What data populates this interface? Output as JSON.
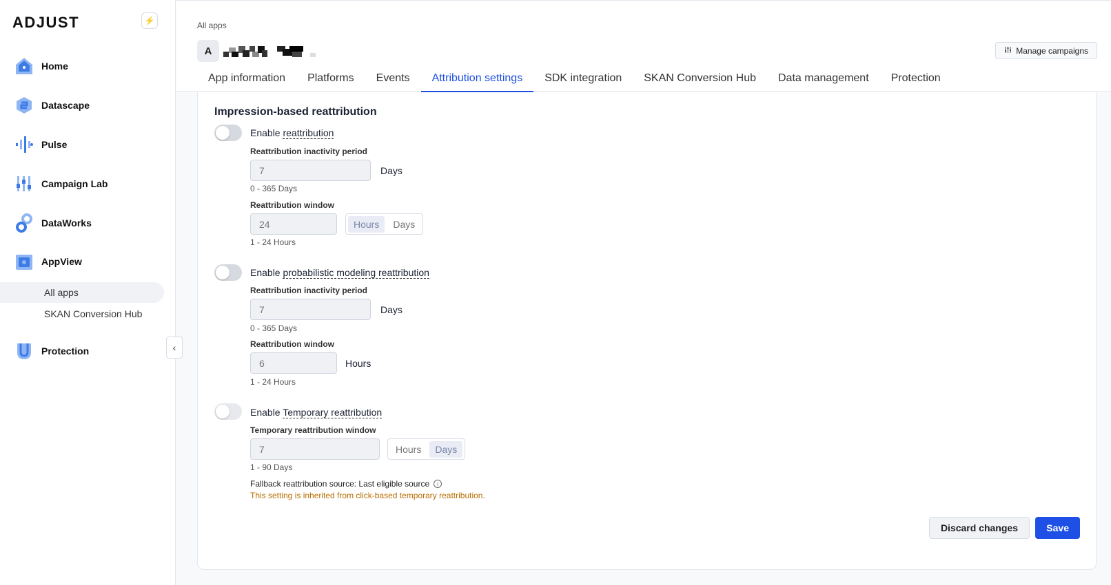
{
  "sidebar": {
    "logo": "ADJUST",
    "nav": [
      {
        "label": "Home",
        "icon": "home-icon"
      },
      {
        "label": "Datascape",
        "icon": "datascape-icon"
      },
      {
        "label": "Pulse",
        "icon": "pulse-icon"
      },
      {
        "label": "Campaign Lab",
        "icon": "campaign-lab-icon"
      },
      {
        "label": "DataWorks",
        "icon": "dataworks-icon"
      },
      {
        "label": "AppView",
        "icon": "appview-icon"
      },
      {
        "label": "Protection",
        "icon": "protection-icon"
      }
    ],
    "sub_items": [
      "All apps",
      "SKAN Conversion Hub"
    ]
  },
  "header": {
    "breadcrumb": "All apps",
    "app_initial": "A",
    "manage_campaigns": "Manage campaigns",
    "tabs": [
      "App information",
      "Platforms",
      "Events",
      "Attribution settings",
      "SDK integration",
      "SKAN Conversion Hub",
      "Data management",
      "Protection"
    ],
    "active_tab": "Attribution settings"
  },
  "content": {
    "section_title": "Impression-based reattribution",
    "reattribution": {
      "toggle_prefix": "Enable",
      "toggle_term": "reattribution",
      "inactivity_label": "Reattribution inactivity period",
      "inactivity_value": "7",
      "inactivity_unit": "Days",
      "inactivity_hint": "0 - 365 Days",
      "window_label": "Reattribution window",
      "window_value": "24",
      "window_units": [
        "Hours",
        "Days"
      ],
      "window_selected": "Hours",
      "window_hint": "1 - 24 Hours"
    },
    "probabilistic": {
      "toggle_prefix": "Enable",
      "toggle_term": "probabilistic modeling reattribution",
      "inactivity_label": "Reattribution inactivity period",
      "inactivity_value": "7",
      "inactivity_unit": "Days",
      "inactivity_hint": "0 - 365 Days",
      "window_label": "Reattribution window",
      "window_value": "6",
      "window_unit": "Hours",
      "window_hint": "1 - 24 Hours"
    },
    "temporary": {
      "toggle_prefix": "Enable",
      "toggle_term": "Temporary reattribution",
      "window_label": "Temporary reattribution window",
      "window_value": "7",
      "window_units": [
        "Hours",
        "Days"
      ],
      "window_selected": "Days",
      "window_hint": "1 - 90 Days",
      "fallback": "Fallback reattribution source: Last eligible source",
      "warning": "This setting is inherited from click-based temporary reattribution."
    },
    "discard_label": "Discard changes",
    "save_label": "Save"
  },
  "colors": {
    "accent": "#1e50e6",
    "warning": "#b86e00",
    "icon_blue": "#3d7be6"
  }
}
